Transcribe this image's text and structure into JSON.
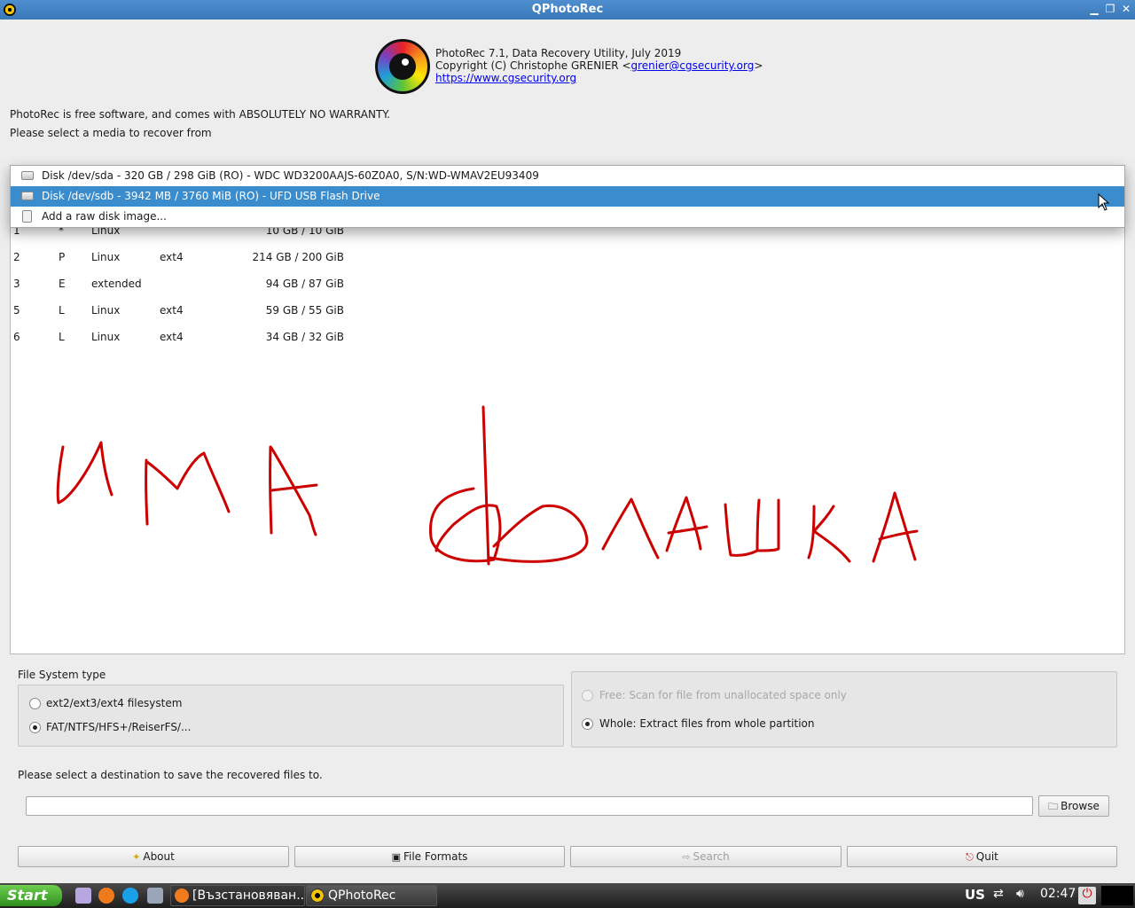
{
  "window": {
    "title": "QPhotoRec"
  },
  "header": {
    "line1": "PhotoRec 7.1, Data Recovery Utility, July 2019",
    "copyright_prefix": "Copyright (C) Christophe GRENIER <",
    "email": "grenier@cgsecurity.org",
    "copyright_suffix": ">",
    "website": "https://www.cgsecurity.org"
  },
  "notice": "PhotoRec is free software, and comes with ABSOLUTELY NO WARRANTY.",
  "media_prompt": "Please select a media to recover from",
  "media_dropdown": {
    "items": [
      {
        "label": "Disk /dev/sda - 320 GB / 298 GiB (RO) - WDC WD3200AAJS-60Z0A0, S/N:WD-WMAV2EU93409",
        "icon": "disk-icon",
        "selected": false
      },
      {
        "label": "Disk /dev/sdb - 3942 MB / 3760 MiB (RO) - UFD USB Flash Drive",
        "icon": "disk-icon",
        "selected": true
      },
      {
        "label": "Add a raw disk image...",
        "icon": "disk-image-icon",
        "selected": false
      }
    ]
  },
  "partitions": [
    {
      "num": "1",
      "flag": "*",
      "type": "Linux",
      "fs": "",
      "size": "10 GB / 10 GiB"
    },
    {
      "num": "2",
      "flag": "P",
      "type": "Linux",
      "fs": "ext4",
      "size": "214 GB / 200 GiB"
    },
    {
      "num": "3",
      "flag": "E",
      "type": "extended",
      "fs": "",
      "size": "94 GB / 87 GiB"
    },
    {
      "num": "5",
      "flag": "L",
      "type": "Linux",
      "fs": "ext4",
      "size": "59 GB / 55 GiB"
    },
    {
      "num": "6",
      "flag": "L",
      "type": "Linux",
      "fs": "ext4",
      "size": "34 GB / 32 GiB"
    }
  ],
  "handwriting_color": "#cc0000",
  "fs_type": {
    "title": "File System type",
    "options": [
      {
        "label": "ext2/ext3/ext4 filesystem",
        "checked": false
      },
      {
        "label": "FAT/NTFS/HFS+/ReiserFS/...",
        "checked": true
      }
    ]
  },
  "scan_scope": {
    "options": [
      {
        "label": "Free: Scan for file from unallocated space only",
        "checked": false,
        "disabled": true
      },
      {
        "label": "Whole: Extract files from whole partition",
        "checked": true,
        "disabled": false
      }
    ]
  },
  "destination": {
    "prompt": "Please select a destination to save the recovered files to.",
    "value": "",
    "browse_label": "Browse"
  },
  "buttons": {
    "about": "About",
    "file_formats": "File Formats",
    "search": "Search",
    "quit": "Quit"
  },
  "taskbar": {
    "start": "Start",
    "tasks": [
      {
        "label": "[Възстановяван...",
        "active": false
      },
      {
        "label": "QPhotoRec",
        "active": true
      }
    ],
    "keyboard_layout": "US",
    "clock": "02:47"
  }
}
